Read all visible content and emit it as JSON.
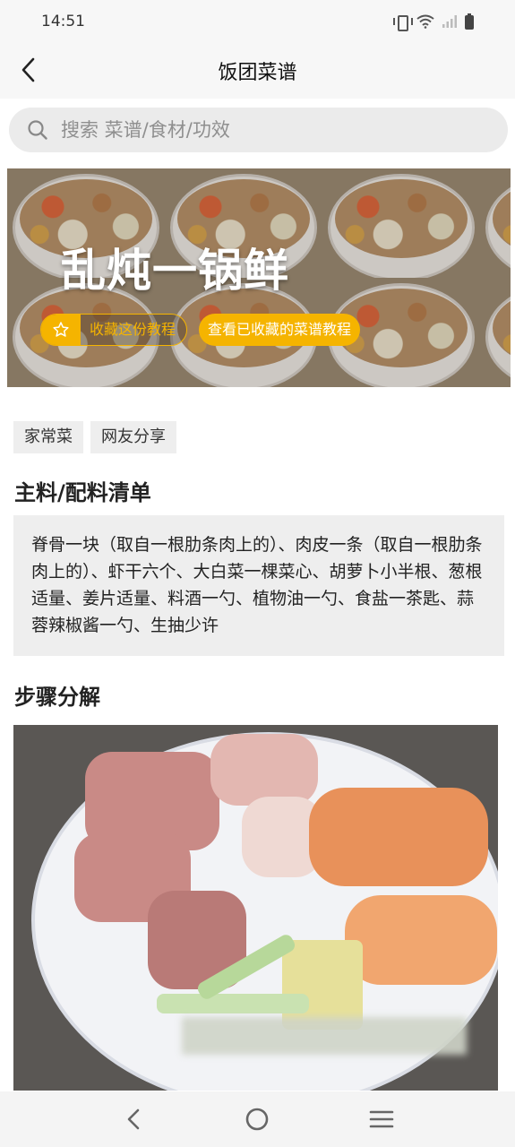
{
  "status_bar": {
    "time": "14:51"
  },
  "nav": {
    "title": "饭团菜谱"
  },
  "search": {
    "placeholder": "搜索 菜谱/食材/功效"
  },
  "banner": {
    "title": "乱炖一锅鲜",
    "favorite_label": "收藏这份教程",
    "view_favorites_label": "查看已收藏的菜谱教程"
  },
  "tags": [
    "家常菜",
    "网友分享"
  ],
  "ingredients": {
    "heading": "主料/配料清单",
    "text": "脊骨一块（取自一根肋条肉上的）、肉皮一条（取自一根肋条肉上的）、虾干六个、大白菜一棵菜心、胡萝卜小半根、葱根适量、姜片适量、料酒一勺、植物油一勺、食盐一茶匙、蒜蓉辣椒酱一勺、生抽少许"
  },
  "steps": {
    "heading": "步骤分解"
  },
  "colors": {
    "accent": "#f5b400",
    "tag_bg": "#eeeeee",
    "search_bg": "#ebebeb"
  },
  "icons": [
    "vibrate-icon",
    "wifi-icon",
    "signal-icon",
    "battery-icon",
    "back-arrow-icon",
    "search-icon",
    "star-icon",
    "nav-back-icon",
    "nav-home-icon",
    "nav-menu-icon"
  ]
}
